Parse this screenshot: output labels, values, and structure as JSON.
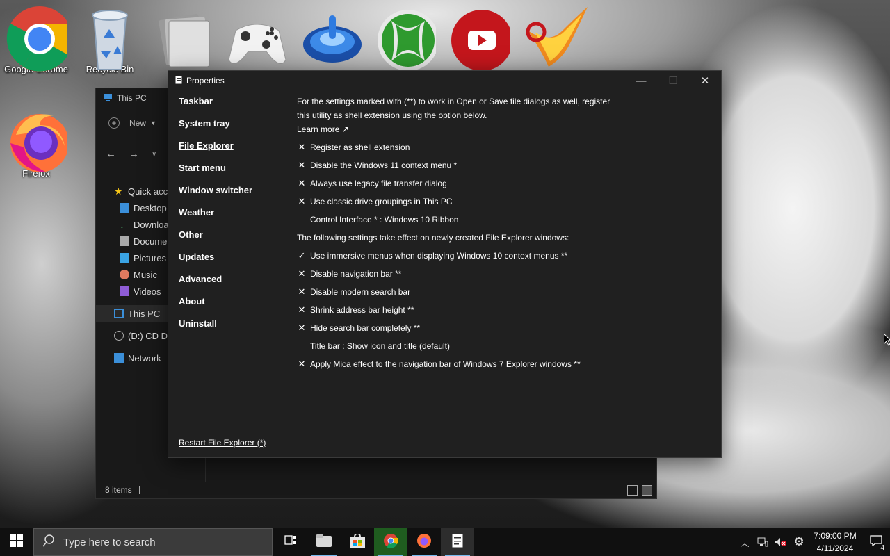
{
  "desktop": {
    "icons": [
      {
        "label": "Google Chrome"
      },
      {
        "label": "Recycle Bin"
      },
      {
        "label": "Firefox"
      }
    ]
  },
  "explorer": {
    "title": "This PC",
    "new_label": "New",
    "nav_items": {
      "quick": "Quick acce",
      "desktop": "Desktop",
      "downloads": "Downloa",
      "documents": "Docume",
      "pictures": "Pictures",
      "music": "Music",
      "videos": "Videos",
      "this_pc": "This PC",
      "cd_drive": "(D:) CD Dr",
      "network": "Network"
    },
    "status_items": "8 items"
  },
  "properties": {
    "title": "Properties",
    "sidebar": [
      "Taskbar",
      "System tray",
      "File Explorer",
      "Start menu",
      "Window switcher",
      "Weather",
      "Other",
      "Updates",
      "Advanced",
      "About",
      "Uninstall"
    ],
    "active_item": "File Explorer",
    "restart_link": "Restart File Explorer (*)",
    "intro_line1": "For the settings marked with (**) to work in Open or Save file dialogs as well, register",
    "intro_line2": "this utility as shell extension using the option below.",
    "learn_more": "Learn more ↗",
    "options_group1": [
      {
        "mark": "✕",
        "label": "Register as shell extension"
      },
      {
        "mark": "✕",
        "label": "Disable the Windows 11 context menu *"
      },
      {
        "mark": "✕",
        "label": "Always use legacy file transfer dialog"
      },
      {
        "mark": "✕",
        "label": "Use classic drive groupings in This PC"
      },
      {
        "mark": "",
        "label": "Control Interface * : Windows 10 Ribbon"
      }
    ],
    "section_text": "The following settings take effect on newly created File Explorer windows:",
    "options_group2": [
      {
        "mark": "✓",
        "label": "Use immersive menus when displaying Windows 10 context menus **"
      },
      {
        "mark": "✕",
        "label": "Disable navigation bar **"
      },
      {
        "mark": "✕",
        "label": "Disable modern search bar"
      },
      {
        "mark": "✕",
        "label": "Shrink address bar height **"
      },
      {
        "mark": "✕",
        "label": "Hide search bar completely **"
      },
      {
        "mark": "",
        "label": "Title bar : Show icon and title (default)"
      },
      {
        "mark": "✕",
        "label": "Apply Mica effect to the navigation bar of Windows 7 Explorer windows **"
      }
    ]
  },
  "taskbar": {
    "search_placeholder": "Type here to search",
    "time": "7:09:00 PM",
    "date": "4/11/2024",
    "notification_count": "4"
  }
}
